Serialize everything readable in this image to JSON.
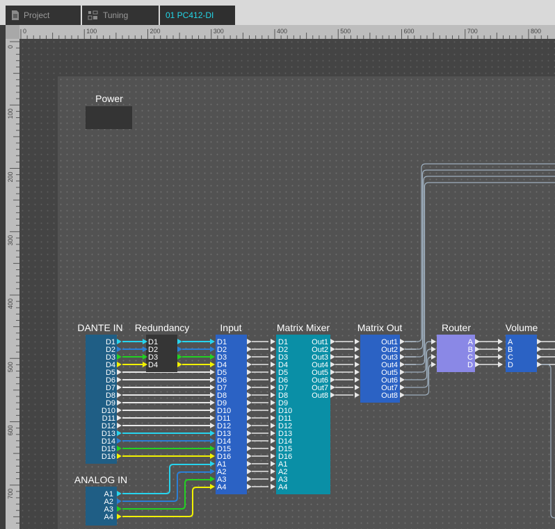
{
  "tabs": [
    {
      "label": "Project",
      "icon": "document-icon"
    },
    {
      "label": "Tuning",
      "icon": "tuning-icon"
    },
    {
      "label": "01 PC412-DI",
      "icon": ""
    }
  ],
  "ruler": {
    "top_labels": [
      "0",
      "100",
      "200",
      "300",
      "400",
      "500",
      "600",
      "700",
      "800"
    ],
    "left_labels": [
      "0",
      "100",
      "200",
      "300",
      "400",
      "500",
      "600",
      "700"
    ]
  },
  "power": {
    "label": "Power"
  },
  "blocks": {
    "dante_in": {
      "title": "DANTE IN",
      "ports": [
        "D1",
        "D2",
        "D3",
        "D4",
        "D5",
        "D6",
        "D7",
        "D8",
        "D9",
        "D10",
        "D11",
        "D12",
        "D13",
        "D14",
        "D15",
        "D16"
      ]
    },
    "analog_in": {
      "title": "ANALOG IN",
      "ports": [
        "A1",
        "A2",
        "A3",
        "A4"
      ]
    },
    "redundancy": {
      "title": "Redundancy",
      "ports": [
        "D1",
        "D2",
        "D3",
        "D4"
      ]
    },
    "input": {
      "title": "Input",
      "ports": [
        "D1",
        "D2",
        "D3",
        "D4",
        "D5",
        "D6",
        "D7",
        "D8",
        "D9",
        "D10",
        "D11",
        "D12",
        "D13",
        "D14",
        "D15",
        "D16",
        "A1",
        "A2",
        "A3",
        "A4"
      ]
    },
    "matrix_mixer": {
      "title": "Matrix Mixer",
      "in_ports": [
        "D1",
        "D2",
        "D3",
        "D4",
        "D5",
        "D6",
        "D7",
        "D8",
        "D9",
        "D10",
        "D11",
        "D12",
        "D13",
        "D14",
        "D15",
        "D16",
        "A1",
        "A2",
        "A3",
        "A4"
      ],
      "out_ports": [
        "Out1",
        "Out2",
        "Out3",
        "Out4",
        "Out5",
        "Out6",
        "Out7",
        "Out8"
      ]
    },
    "matrix_out": {
      "title": "Matrix Out",
      "ports": [
        "Out1",
        "Out2",
        "Out3",
        "Out4",
        "Out5",
        "Out6",
        "Out7",
        "Out8"
      ]
    },
    "router": {
      "title": "Router",
      "ports": [
        "A",
        "B",
        "C",
        "D"
      ]
    },
    "volume": {
      "title": "Volume",
      "ports": [
        "A",
        "B",
        "C",
        "D"
      ]
    }
  },
  "colors": {
    "cyan": "#27d4ee",
    "blue": "#2a7fd6",
    "green": "#22d122",
    "yellow": "#f2f200",
    "white": "#e8e8e8",
    "wire_gray": "#9fb0c0"
  }
}
